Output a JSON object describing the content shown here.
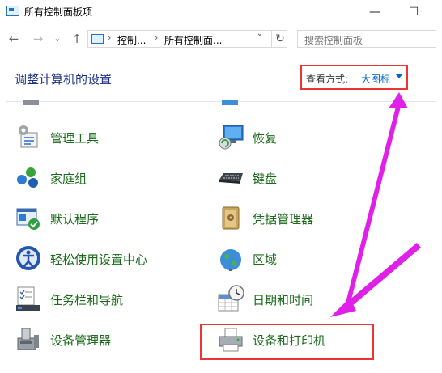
{
  "window": {
    "title": "所有控制面板项",
    "minimize": "—",
    "maximize": "☐"
  },
  "nav": {
    "back": "←",
    "forward": "→",
    "recent": "⌄",
    "up": "↑",
    "breadcrumb": [
      "控制...",
      "所有控制面..."
    ],
    "refresh": "↻",
    "search_placeholder": "搜索控制面板"
  },
  "header": {
    "title": "调整计算机的设置",
    "view_label": "查看方式:",
    "view_value": "大图标"
  },
  "items_left": [
    {
      "label": "管理工具",
      "icon": "admin-tools-icon"
    },
    {
      "label": "家庭组",
      "icon": "homegroup-icon"
    },
    {
      "label": "默认程序",
      "icon": "default-programs-icon"
    },
    {
      "label": "轻松使用设置中心",
      "icon": "ease-of-access-icon"
    },
    {
      "label": "任务栏和导航",
      "icon": "taskbar-icon"
    },
    {
      "label": "设备管理器",
      "icon": "device-manager-icon"
    }
  ],
  "items_right": [
    {
      "label": "恢复",
      "icon": "recovery-icon"
    },
    {
      "label": "键盘",
      "icon": "keyboard-icon"
    },
    {
      "label": "凭据管理器",
      "icon": "credential-manager-icon"
    },
    {
      "label": "区域",
      "icon": "region-icon"
    },
    {
      "label": "日期和时间",
      "icon": "date-time-icon"
    },
    {
      "label": "设备和打印机",
      "icon": "devices-printers-icon"
    }
  ],
  "colors": {
    "link_green": "#1b6b1b",
    "heading_blue": "#1e3287",
    "annotation_red": "#e33333",
    "annotation_magenta": "#e020e8"
  }
}
